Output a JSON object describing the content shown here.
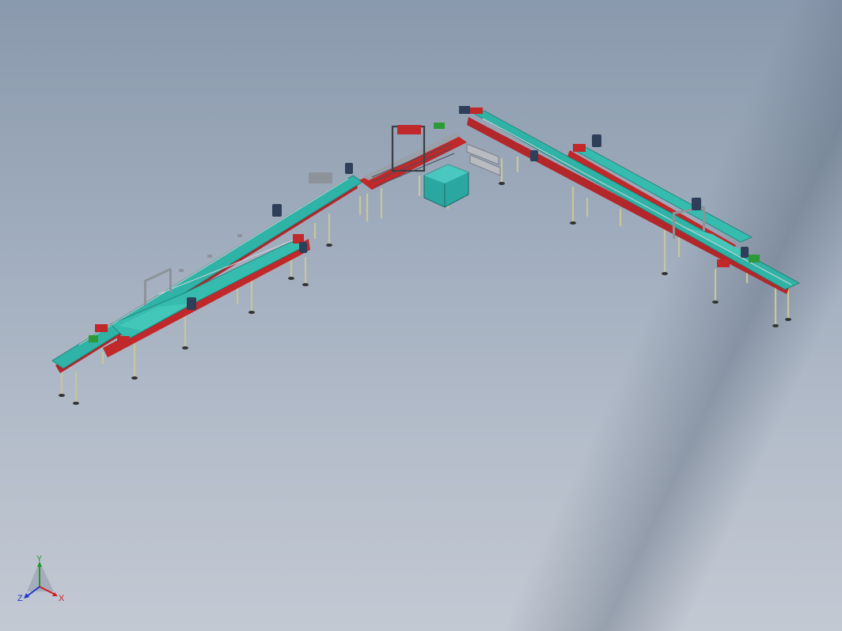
{
  "viewport": {
    "background_top": "#8a99ad",
    "background_bottom": "#c3c9d3"
  },
  "model": {
    "description_icon": "conveyor-line-assembly",
    "colors": {
      "belt": "#2fb3a6",
      "frame": "#c0282a",
      "legs": "#c8c69a",
      "motor": "#2f3f5a",
      "cabinet": "#2aa7a0",
      "metal": "#9aa0a8"
    }
  },
  "triad": {
    "x_label": "X",
    "y_label": "Y",
    "z_label": "Z",
    "x_color": "#d01c1c",
    "y_color": "#1f9a2a",
    "z_color": "#2438c8"
  }
}
